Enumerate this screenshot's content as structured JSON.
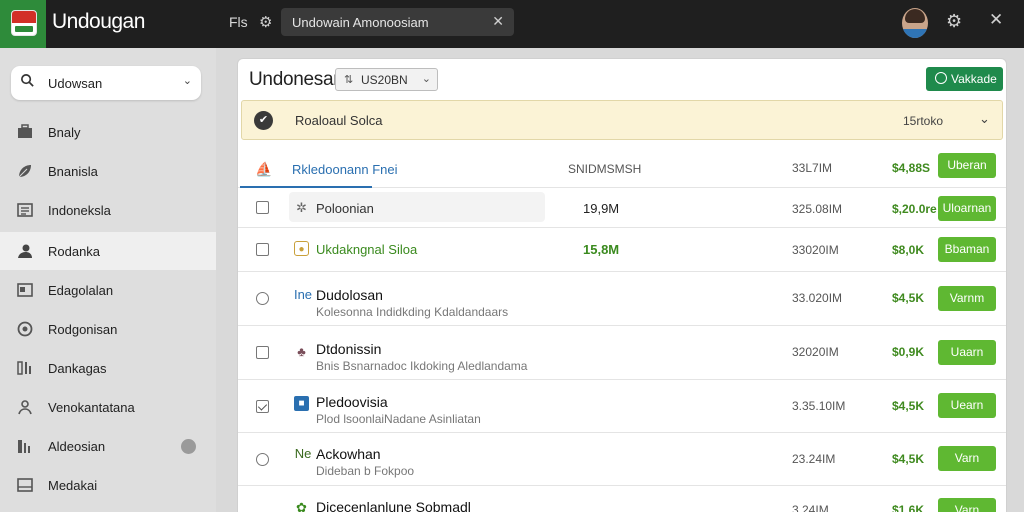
{
  "app": {
    "title": "Undougan"
  },
  "topbar": {
    "menu_file": "Fls",
    "tab_label": "Undowain Amonoosiam",
    "icons": [
      "gear-icon",
      "close-icon"
    ]
  },
  "sidebar": {
    "search_value": "Udowsan",
    "items": [
      {
        "label": "Bnaly",
        "icon": "briefcase-icon"
      },
      {
        "label": "Bnanisla",
        "icon": "leaf-icon"
      },
      {
        "label": "Indoneksla",
        "icon": "document-icon"
      },
      {
        "label": "Rodanka",
        "icon": "users-icon"
      },
      {
        "label": "Edagolalan",
        "icon": "card-icon"
      },
      {
        "label": "Rodgonisan",
        "icon": "globe-icon"
      },
      {
        "label": "Dankagas",
        "icon": "stats-icon"
      },
      {
        "label": "Venokantatana",
        "icon": "person-icon"
      },
      {
        "label": "Aldeosian",
        "icon": "chart-icon"
      },
      {
        "label": "Medakai",
        "icon": "file-icon"
      }
    ]
  },
  "main": {
    "title": "Undonesan",
    "dropdown_value": "US20BN",
    "validate_label": "Vakkade",
    "notice": {
      "text": "Roaloaul Solca",
      "value": "15rtoko"
    },
    "header": {
      "name": "Rkledoonann Fnei",
      "column": "SNIDMSMSH"
    },
    "rows": [
      {
        "name": "Poloonian",
        "sub": "",
        "qty": "19,9M",
        "value": "325.08IM",
        "price": "$,20.0re",
        "button": "Uloarnan"
      },
      {
        "name": "Ukdakngnal Siloa",
        "sub": "",
        "qty": "15,8M",
        "value": "33020IM",
        "price": "$8,0K",
        "button": "Bbaman"
      },
      {
        "name": "Dudolosan",
        "prefix": "Ine",
        "sub": "Kolesonna Indidkding Kdaldandaars",
        "qty": "",
        "value": "33.020IM",
        "price": "$4,5K",
        "button": "Varnm"
      },
      {
        "name": "Dtdonissin",
        "sub": "Bnis Bsnarnadoc Ikdoking Aledlandama",
        "qty": "",
        "value": "32020IM",
        "price": "$0,9K",
        "button": "Uaarn"
      },
      {
        "name": "Pledoovisia",
        "sub": "Plod lsoonlaiNadane Asinliatan",
        "qty": "",
        "value": "3.35.10IM",
        "price": "$4,5K",
        "button": "Uearn"
      },
      {
        "name": "Ackowhan",
        "prefix": "Ne",
        "sub": "Dideban b Fokpoo",
        "qty": "",
        "value": "23.24IM",
        "price": "$4,5K",
        "button": "Varn"
      },
      {
        "name": "Dicecenlanlune Sobmadl",
        "sub": "",
        "qty": "",
        "value": "3.24IM",
        "price": "$1,6K",
        "button": "Varn"
      }
    ],
    "header_row": {
      "value": "33L7IM",
      "price": "$4,88S",
      "button": "Uberan"
    }
  },
  "colors": {
    "accent_green": "#5fb832",
    "brand_green": "#2e8b3a",
    "link_blue": "#2a6fb0",
    "notice_bg": "#fbf3d6"
  }
}
